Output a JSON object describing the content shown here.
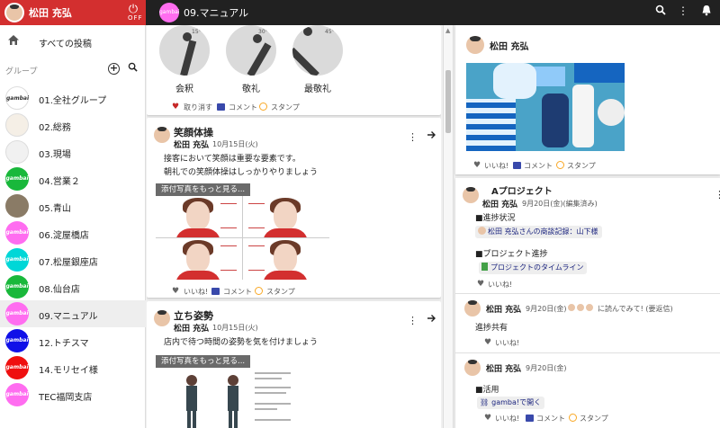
{
  "topbar": {
    "user_name": "松田 充弘",
    "power_caption": "OFF",
    "group_avatar_text": "gambai",
    "group_title": "09.マニュアル",
    "icons": [
      "search-icon",
      "more-vert-icon",
      "bell-icon"
    ]
  },
  "sidebar": {
    "all_posts_label": "すべての投稿",
    "group_heading": "グループ",
    "groups": [
      {
        "label": "01.全社グループ",
        "color": "#ffffff",
        "icon_text": "gambai"
      },
      {
        "label": "02.総務",
        "color": "#f5efe6",
        "icon_text": ""
      },
      {
        "label": "03.現場",
        "color": "#f1f1f1",
        "icon_text": ""
      },
      {
        "label": "04.営業２",
        "color": "#19b83b",
        "icon_text": "gambai"
      },
      {
        "label": "05.青山",
        "color": "#8a7b66",
        "icon_text": ""
      },
      {
        "label": "06.淀屋橋店",
        "color": "#ff6df0",
        "icon_text": "gambai"
      },
      {
        "label": "07.松屋銀座店",
        "color": "#00d7d7",
        "icon_text": "gambai"
      },
      {
        "label": "08.仙台店",
        "color": "#19b83b",
        "icon_text": "gambai"
      },
      {
        "label": "09.マニュアル",
        "color": "#ff6df0",
        "icon_text": "gambai"
      },
      {
        "label": "12.トチスマ",
        "color": "#1010e8",
        "icon_text": "gambai"
      },
      {
        "label": "14.モリセイ様",
        "color": "#ef1010",
        "icon_text": "gambai"
      },
      {
        "label": "TEC福岡支店",
        "color": "#ff6df0",
        "icon_text": "gambai"
      }
    ]
  },
  "feed": {
    "bow_card": {
      "bows": [
        {
          "label": "会釈",
          "angle": "15°"
        },
        {
          "label": "敬礼",
          "angle": "30°"
        },
        {
          "label": "最敬礼",
          "angle": "45°"
        }
      ],
      "unlike_label": "取り消す",
      "comment_label": "コメント",
      "stamp_label": "スタンプ"
    },
    "post1": {
      "title": "笑顔体操",
      "author": "松田 充弘",
      "date": "10月15日(火)",
      "body_line1": "接客において笑顔は重要な要素です。",
      "body_line2": "朝礼での笑顔体操はしっかりやりましょう",
      "more_photos_label": "添付写真をもっと見る...",
      "like_label": "いいね!",
      "comment_label": "コメント",
      "stamp_label": "スタンプ"
    },
    "post2": {
      "title": "立ち姿勢",
      "author": "松田 充弘",
      "date": "10月15日(火)",
      "body_line1": "店内で待つ時間の姿勢を気を付けましょう",
      "more_photos_label": "添付写真をもっと見る..."
    }
  },
  "right": {
    "card1": {
      "author": "松田 充弘",
      "like_label": "いいね!",
      "comment_label": "コメント",
      "stamp_label": "スタンプ"
    },
    "card2": {
      "title": "Aプロジェクト",
      "author": "松田 充弘",
      "date": "9月20日(金)(編集済み)",
      "section1": "■進捗状況",
      "chip1": "松田 充弘さんの商談記録：山下様",
      "section2": "■プロジェクト進捗",
      "chip2": "プロジェクトのタイムライン",
      "like_label": "いいね!",
      "reply1": {
        "author": "松田 充弘",
        "date": "9月20日(金)",
        "read_note": "に読んでみて! (要返信)",
        "body": "進捗共有",
        "like_label": "いいね!"
      },
      "reply2": {
        "author": "松田 充弘",
        "date": "9月20日(金)",
        "section": "■活用",
        "chip": "gamba!で開く",
        "like_label": "いいね!",
        "comment_label": "コメント",
        "stamp_label": "スタンプ"
      }
    }
  },
  "colors": {
    "topbar": "#212121",
    "user_block": "#d32f2f",
    "like_red": "#c62828",
    "comment_blue": "#3949ab",
    "stamp_yellow": "#f9a825"
  }
}
